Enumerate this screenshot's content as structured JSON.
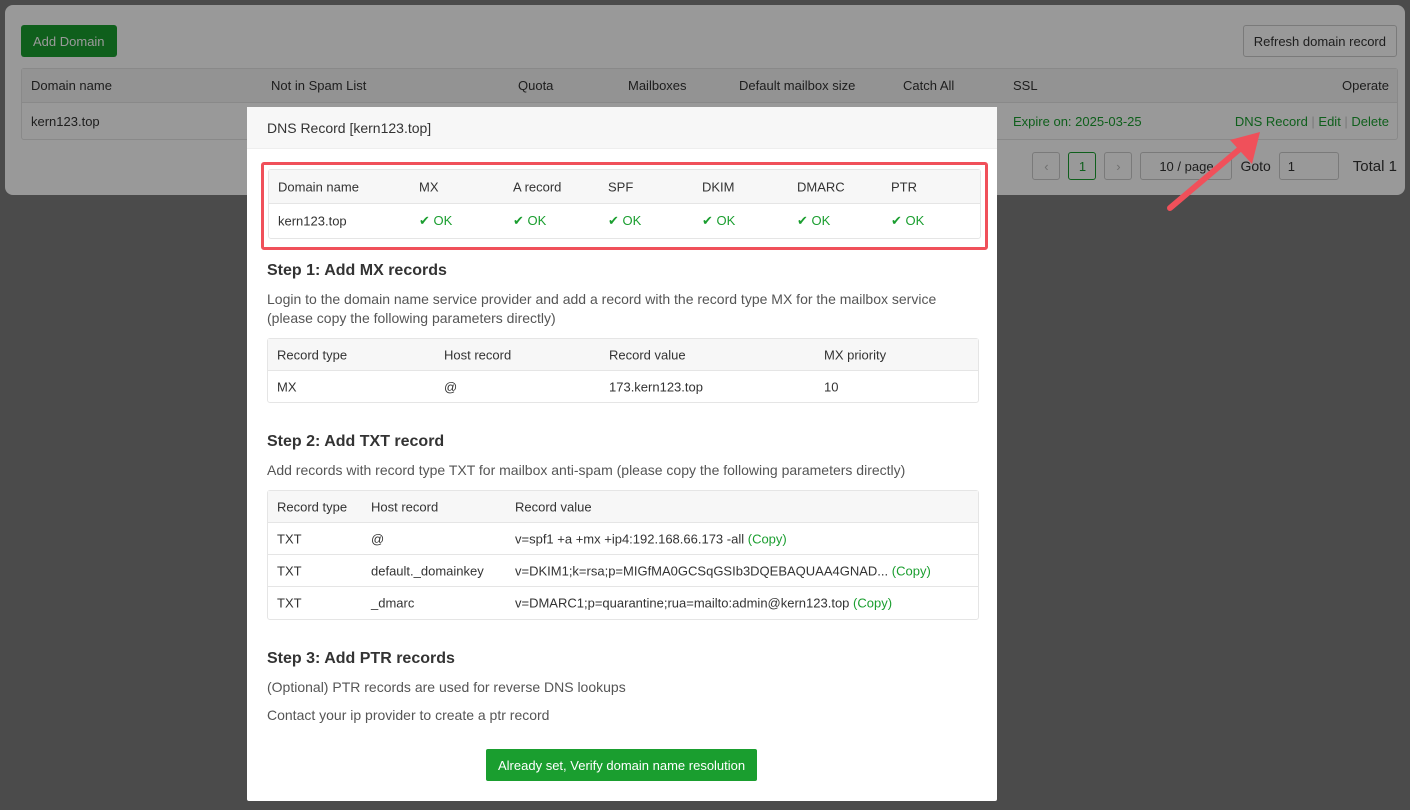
{
  "toolbar": {
    "add_domain": "Add Domain",
    "refresh": "Refresh domain record"
  },
  "domain_table": {
    "headers": [
      "Domain name",
      "Not in Spam List",
      "Quota",
      "Mailboxes",
      "Default mailbox size",
      "Catch All",
      "SSL",
      "Operate"
    ],
    "row": {
      "domain": "kern123.top",
      "ssl": "Expire on: 2025-03-25",
      "actions": [
        "DNS Record",
        "Edit",
        "Delete"
      ]
    }
  },
  "pagination": {
    "prev": "‹",
    "page": "1",
    "next": "›",
    "page_size": "10 / page",
    "goto_label": "Goto",
    "goto_value": "1",
    "total": "Total 1"
  },
  "modal": {
    "title": "DNS Record [kern123.top]",
    "status": {
      "headers": [
        "Domain name",
        "MX",
        "A record",
        "SPF",
        "DKIM",
        "DMARC",
        "PTR"
      ],
      "domain": "kern123.top",
      "values": [
        "OK",
        "OK",
        "OK",
        "OK",
        "OK",
        "OK"
      ]
    },
    "step1": {
      "title": "Step 1: Add MX records",
      "desc": "Login to the domain name service provider and add a record with the record type MX for the mailbox service (please copy the following parameters directly)",
      "headers": [
        "Record type",
        "Host record",
        "Record value",
        "MX priority"
      ],
      "row": [
        "MX",
        "@",
        "173.kern123.top",
        "10"
      ]
    },
    "step2": {
      "title": "Step 2: Add TXT record",
      "desc": "Add records with record type TXT for mailbox anti-spam (please copy the following parameters directly)",
      "headers": [
        "Record type",
        "Host record",
        "Record value"
      ],
      "rows": [
        [
          "TXT",
          "@",
          "v=spf1 +a +mx +ip4:192.168.66.173 -all"
        ],
        [
          "TXT",
          "default._domainkey",
          "v=DKIM1;k=rsa;p=MIGfMA0GCSqGSIb3DQEBAQUAA4GNAD..."
        ],
        [
          "TXT",
          "_dmarc",
          "v=DMARC1;p=quarantine;rua=mailto:admin@kern123.top"
        ]
      ],
      "copy": "(Copy)"
    },
    "step3": {
      "title": "Step 3: Add PTR records",
      "line1": "(Optional) PTR records are used for reverse DNS lookups",
      "line2": "Contact your ip provider to create a ptr record"
    },
    "verify": "Already set, Verify domain name resolution"
  },
  "colors": {
    "accent": "#1a9e2f",
    "highlight": "#f0505a"
  }
}
